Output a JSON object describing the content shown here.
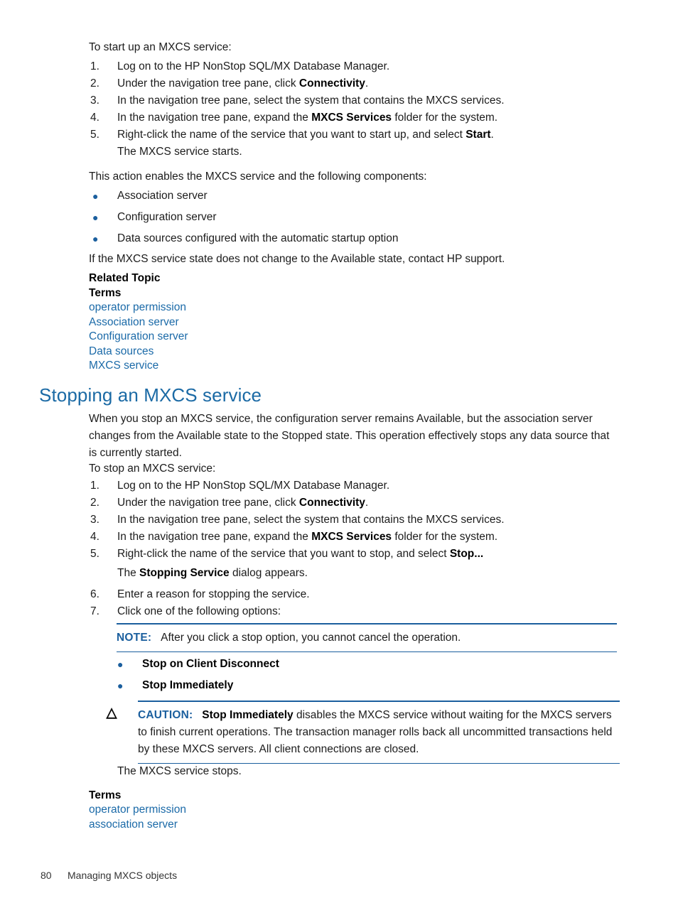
{
  "section_start": {
    "intro": "To start up an MXCS service:",
    "steps": [
      {
        "num": "1.",
        "pre": "Log on to the HP NonStop SQL/MX Database Manager.",
        "bold": "",
        "post": ""
      },
      {
        "num": "2.",
        "pre": "Under the navigation tree pane, click ",
        "bold": "Connectivity",
        "post": "."
      },
      {
        "num": "3.",
        "pre": "In the navigation tree pane, select the system that contains the MXCS services.",
        "bold": "",
        "post": ""
      },
      {
        "num": "4.",
        "pre": "In the navigation tree pane, expand the ",
        "bold": "MXCS Services",
        "post": " folder for the system."
      },
      {
        "num": "5.",
        "pre": "Right-click the name of the service that you want to start up, and select ",
        "bold": "Start",
        "post": "."
      }
    ],
    "step_result": "The MXCS service starts.",
    "components_intro": "This action enables the MXCS service and the following components:",
    "components": [
      "Association server",
      "Configuration server",
      "Data sources configured with the automatic startup option"
    ],
    "closing": "If the MXCS service state does not change to the Available state, contact HP support.",
    "related_topic_label": "Related Topic",
    "terms_label": "Terms",
    "terms": [
      "operator permission",
      "Association server",
      "Configuration server",
      "Data sources",
      "MXCS service"
    ]
  },
  "section_stop": {
    "heading": "Stopping an MXCS service",
    "overview": "When you stop an MXCS service, the configuration server remains Available, but the association server changes from the Available state to the Stopped state. This operation effectively stops any data source that is currently started.",
    "intro": "To stop an MXCS service:",
    "steps": [
      {
        "num": "1.",
        "pre": "Log on to the HP NonStop SQL/MX Database Manager.",
        "bold": "",
        "post": ""
      },
      {
        "num": "2.",
        "pre": "Under the navigation tree pane, click ",
        "bold": "Connectivity",
        "post": "."
      },
      {
        "num": "3.",
        "pre": "In the navigation tree pane, select the system that contains the MXCS services.",
        "bold": "",
        "post": ""
      },
      {
        "num": "4.",
        "pre": "In the navigation tree pane, expand the ",
        "bold": "MXCS Services",
        "post": " folder for the system."
      },
      {
        "num": "5.",
        "pre": "Right-click the name of the service that you want to stop, and select ",
        "bold": "Stop...",
        "post": ""
      }
    ],
    "step5_result_pre": "The ",
    "step5_result_bold": "Stopping Service",
    "step5_result_post": " dialog appears.",
    "steps_tail": [
      {
        "num": "6.",
        "pre": "Enter a reason for stopping the service.",
        "bold": "",
        "post": ""
      },
      {
        "num": "7.",
        "pre": "Click one of the following options:",
        "bold": "",
        "post": ""
      }
    ],
    "note": {
      "label": "NOTE:",
      "text": "After you click a stop option, you cannot cancel the operation."
    },
    "options": [
      "Stop on Client Disconnect",
      "Stop Immediately"
    ],
    "caution": {
      "icon": "△",
      "label": "CAUTION:",
      "bold_lead": "Stop Immediately",
      "text": " disables the MXCS service without waiting for the MXCS servers to finish current operations. The transaction manager rolls back all uncommitted transactions held by these MXCS servers. All client connections are closed."
    },
    "result": "The MXCS service stops.",
    "terms_label": "Terms",
    "terms": [
      "operator permission",
      "association server"
    ]
  },
  "footer": {
    "page_number": "80",
    "chapter_title": "Managing MXCS objects"
  },
  "colors": {
    "link": "#1b6aa8",
    "heading": "#1b6aa5",
    "admonition": "#1b5f9e",
    "body": "#1c1c1c"
  }
}
